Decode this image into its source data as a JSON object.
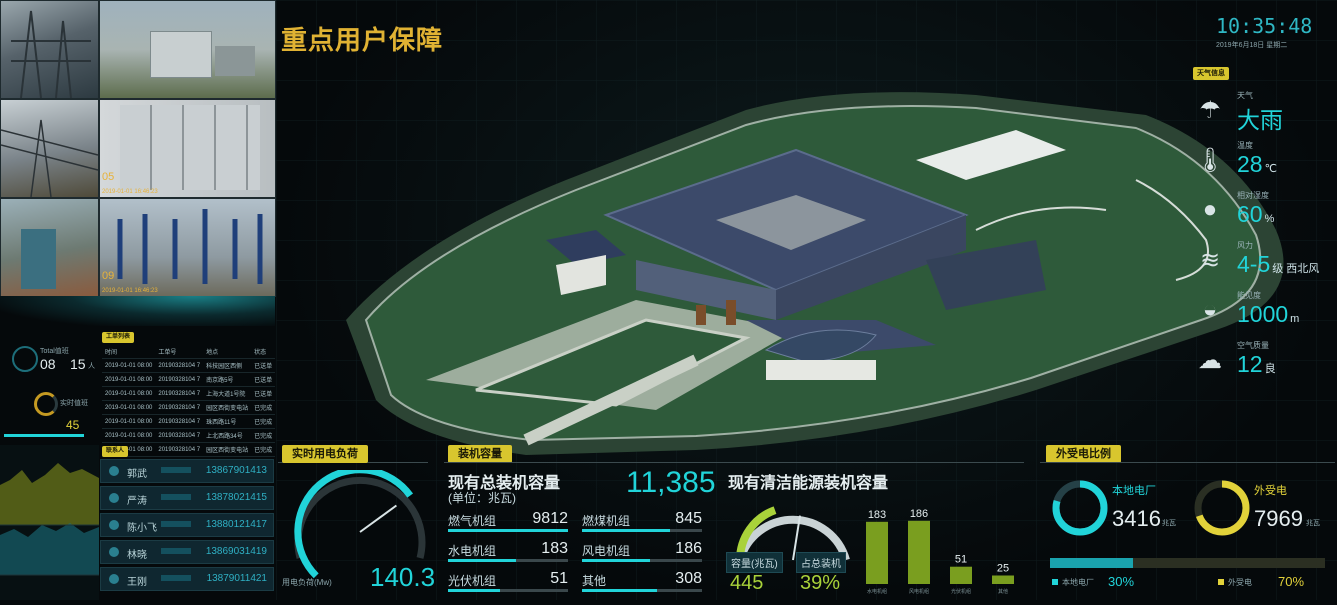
{
  "title": "重点用户保障",
  "clock": {
    "time": "10:35:48",
    "date": "2019年6月18日 星期二"
  },
  "weather": {
    "tag": "天气信息",
    "rows": [
      {
        "label": "天气",
        "value": "大雨",
        "unit": "",
        "icon": "heavy-rain-icon"
      },
      {
        "label": "温度",
        "value": "28",
        "unit": "℃",
        "icon": "thermometer-icon"
      },
      {
        "label": "相对湿度",
        "value": "60",
        "unit": "%",
        "icon": "humidity-drop-icon"
      },
      {
        "label": "风力",
        "value": "4-5",
        "unit": "级 西北风",
        "icon": "wind-icon"
      },
      {
        "label": "能见度",
        "value": "1000",
        "unit": "m",
        "icon": "visibility-sun-icon"
      },
      {
        "label": "空气质量",
        "value": "12",
        "unit": "良",
        "icon": "air-quality-cloud-icon"
      }
    ]
  },
  "cameras": [
    {
      "num": "",
      "cap": ""
    },
    {
      "num": "",
      "cap": ""
    },
    {
      "num": "",
      "cap": ""
    },
    {
      "num": "05",
      "cap": "2019-01-01 16:46:23"
    },
    {
      "num": "",
      "cap": ""
    },
    {
      "num": "09",
      "cap": "2019-01-01 16:46:23"
    }
  ],
  "duty": {
    "tag": "人员值守",
    "label1": "Total值班",
    "num1": "08",
    "num2": "15",
    "unit": "人",
    "label2": "实时值班",
    "num3": "45"
  },
  "worklist": {
    "tag": "工单列表",
    "headers": [
      "时间",
      "工单号",
      "地点",
      "状态"
    ],
    "rows": [
      [
        "2019-01-01 08:00",
        "20190328104 7",
        "科技园区西侧",
        "已送单"
      ],
      [
        "2019-01-01 08:00",
        "20190328104 7",
        "南京路5号",
        "已送单"
      ],
      [
        "2019-01-01 08:00",
        "20190328104 7",
        "上海大道1号院",
        "已送单"
      ],
      [
        "2019-01-01 08:00",
        "20190328104 7",
        "园区西街变电站",
        "已完成"
      ],
      [
        "2019-01-01 08:00",
        "20190328104 7",
        "珠西路11号",
        "已完成"
      ],
      [
        "2019-01-01 08:00",
        "20190328104 7",
        "上北西路34号",
        "已完成"
      ],
      [
        "2019-01-01 08:00",
        "20190328104 7",
        "园区西街变电站",
        "已完成"
      ]
    ]
  },
  "contacts": {
    "tag": "联系人",
    "items": [
      {
        "name": "郭武",
        "phone": "13867901413"
      },
      {
        "name": "严涛",
        "phone": "13878021415"
      },
      {
        "name": "陈小飞",
        "phone": "13880121417"
      },
      {
        "name": "林晓",
        "phone": "13869031419"
      },
      {
        "name": "王刚",
        "phone": "13879011421"
      }
    ]
  },
  "load": {
    "tag": "实时用电负荷",
    "label": "用电负荷(Mw)",
    "value": "140.3",
    "fraction": 0.7
  },
  "capacity": {
    "tag": "装机容量",
    "title": "现有总装机容量",
    "unit": "(单位：兆瓦)",
    "total": "11,385",
    "items": [
      {
        "name": "燃气机组",
        "value": "9812"
      },
      {
        "name": "燃煤机组",
        "value": "845"
      },
      {
        "name": "水电机组",
        "value": "183"
      },
      {
        "name": "风电机组",
        "value": "186"
      },
      {
        "name": "光伏机组",
        "value": "51"
      },
      {
        "name": "其他",
        "value": "308"
      }
    ]
  },
  "clean": {
    "title": "现有清洁能源装机容量",
    "cap_label": "容量(兆瓦)",
    "cap_value": "445",
    "pct_label": "占总装机",
    "pct_value": "39%",
    "fraction": 0.39,
    "chart_data": {
      "type": "bar",
      "categories": [
        "水电机组",
        "风电机组",
        "光伏机组",
        "其他"
      ],
      "values": [
        183,
        186,
        51,
        25
      ],
      "ylim": [
        0,
        200
      ]
    }
  },
  "ratio": {
    "tag": "外受电比例",
    "local_label": "本地电厂",
    "local_value": "3416",
    "local_unit": "兆瓦",
    "ext_label": "外受电",
    "ext_value": "7969",
    "ext_unit": "兆瓦",
    "bar_local_label": "本地电厂",
    "bar_local_pct": "30%",
    "bar_ext_label": "外受电",
    "bar_ext_pct": "70%",
    "local_fraction": 0.3
  },
  "colors": {
    "accent": "#21d4d9",
    "yellow": "#e2d23a",
    "olive": "#6e8f1c"
  }
}
